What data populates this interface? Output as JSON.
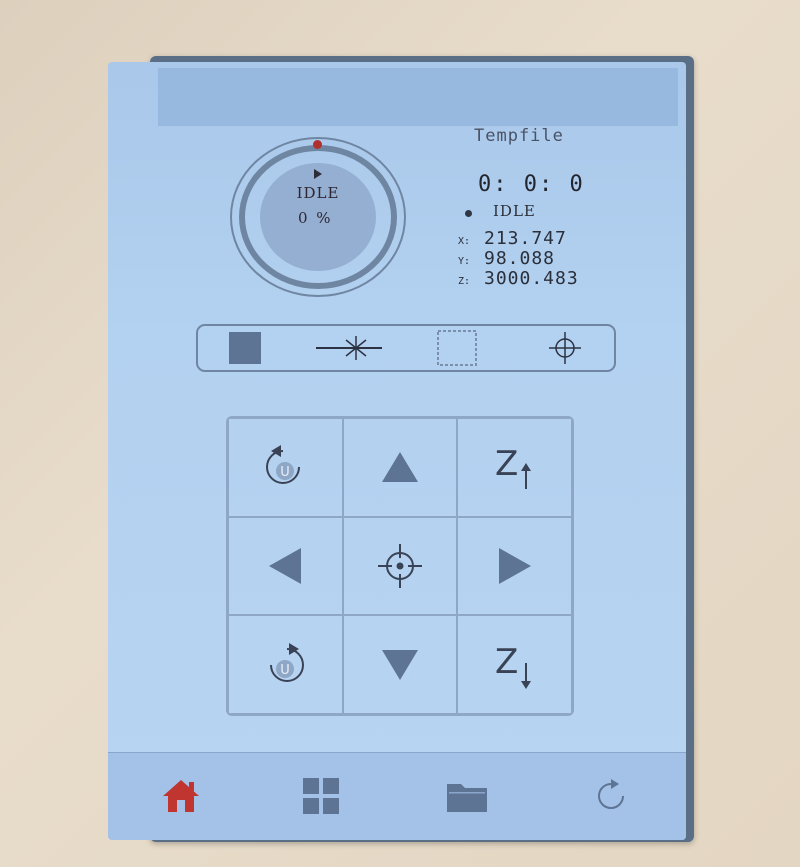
{
  "device": {
    "file_name": "Tempfile",
    "elapsed_time": "0: 0: 0",
    "state": "IDLE",
    "ring_status": "IDLE",
    "progress_text": "0 %",
    "progress_value": 0,
    "coordinates": {
      "x_label": "X:",
      "x_value": "213.747",
      "y_label": "Y:",
      "y_value": "98.088",
      "z_label": "Z:",
      "z_value": "3000.483"
    }
  },
  "toolbar": {
    "items": [
      {
        "name": "start-stop",
        "icon": "filled-square-icon"
      },
      {
        "name": "laser-pulse",
        "icon": "laser-beam-icon"
      },
      {
        "name": "frame",
        "icon": "dashed-square-icon"
      },
      {
        "name": "origin",
        "icon": "crosshair-icon"
      }
    ]
  },
  "jog_pad": {
    "buttons": [
      {
        "name": "u-axis-counterclockwise",
        "icon": "rotate-u-ccw-icon",
        "label": "U"
      },
      {
        "name": "move-up",
        "icon": "arrow-up-icon"
      },
      {
        "name": "z-up",
        "icon": "z-up-icon",
        "label": "Z"
      },
      {
        "name": "move-left",
        "icon": "arrow-left-icon"
      },
      {
        "name": "go-origin",
        "icon": "crosshair-icon"
      },
      {
        "name": "move-right",
        "icon": "arrow-right-icon"
      },
      {
        "name": "u-axis-clockwise",
        "icon": "rotate-u-cw-icon",
        "label": "U"
      },
      {
        "name": "move-down",
        "icon": "arrow-down-icon"
      },
      {
        "name": "z-down",
        "icon": "z-down-icon",
        "label": "Z"
      }
    ]
  },
  "bottom_nav": {
    "items": [
      {
        "name": "home",
        "icon": "home-icon",
        "active": true
      },
      {
        "name": "menu",
        "icon": "grid-icon",
        "active": false
      },
      {
        "name": "files",
        "icon": "folder-icon",
        "active": false
      },
      {
        "name": "refresh",
        "icon": "refresh-icon",
        "active": false
      }
    ]
  },
  "colors": {
    "screen": "#b3d1f0",
    "accent_red": "#b03030",
    "icon": "#5d7494"
  }
}
